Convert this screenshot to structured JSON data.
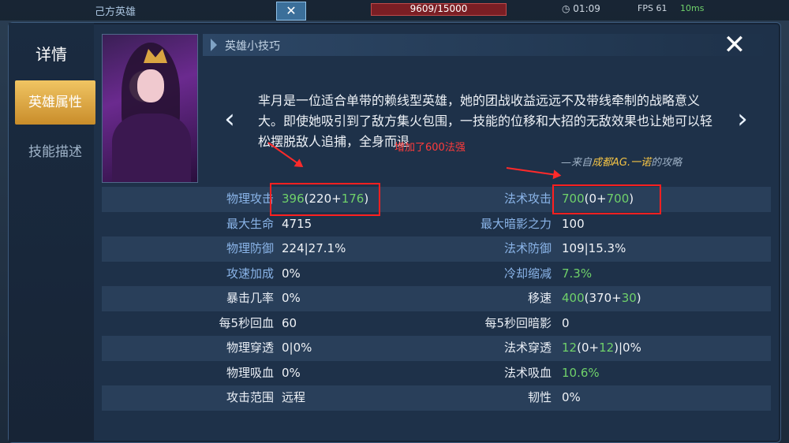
{
  "hud": {
    "ally_label": "己方英雄",
    "hp_text": "9609/15000",
    "time": "01:09",
    "fps": "FPS 61",
    "ping": "10ms"
  },
  "sidebar": {
    "title": "详情",
    "tabs": [
      {
        "label": "英雄属性",
        "active": true
      },
      {
        "label": "技能描述",
        "active": false
      }
    ]
  },
  "tips": {
    "header": "英雄小技巧",
    "text": "芈月是一位适合单带的赖线型英雄，她的团战收益远远不及带线牵制的战略意义大。即使她吸引到了敌方集火包围，一技能的位移和大招的无敌效果也让她可以轻松摆脱敌人追捕，全身而退",
    "source_prefix": "—来自",
    "source_name": "成都AG.一诺",
    "source_suffix": "的攻略"
  },
  "annotation": {
    "label": "增加了600法强",
    "color": "#ff2020"
  },
  "stats": [
    {
      "l_label": "物理攻击",
      "l_color": "blue",
      "l_parts": [
        [
          "396",
          "g"
        ],
        [
          "(220+",
          ""
        ],
        [
          "176",
          "g"
        ],
        [
          ")",
          ""
        ]
      ],
      "r_label": "法术攻击",
      "r_color": "blue",
      "r_parts": [
        [
          "700",
          "g"
        ],
        [
          "(0+",
          ""
        ],
        [
          "700",
          "g"
        ],
        [
          ")",
          ""
        ]
      ]
    },
    {
      "l_label": "最大生命",
      "l_color": "blue",
      "l_parts": [
        [
          "4715",
          ""
        ]
      ],
      "r_label": "最大暗影之力",
      "r_color": "blue",
      "r_parts": [
        [
          "100",
          ""
        ]
      ]
    },
    {
      "l_label": "物理防御",
      "l_color": "blue",
      "l_parts": [
        [
          "224|27.1%",
          ""
        ]
      ],
      "r_label": "法术防御",
      "r_color": "blue",
      "r_parts": [
        [
          "109|15.3%",
          ""
        ]
      ]
    },
    {
      "l_label": "攻速加成",
      "l_color": "blue",
      "l_parts": [
        [
          "0%",
          ""
        ]
      ],
      "r_label": "冷却缩减",
      "r_color": "blue",
      "r_parts": [
        [
          "7.3%",
          "g"
        ]
      ]
    },
    {
      "l_label": "暴击几率",
      "l_color": "white",
      "l_parts": [
        [
          "0%",
          ""
        ]
      ],
      "r_label": "移速",
      "r_color": "white",
      "r_parts": [
        [
          "400",
          "g"
        ],
        [
          "(370+",
          ""
        ],
        [
          "30",
          "g"
        ],
        [
          ")",
          ""
        ]
      ]
    },
    {
      "l_label": "每5秒回血",
      "l_color": "white",
      "l_parts": [
        [
          "60",
          ""
        ]
      ],
      "r_label": "每5秒回暗影",
      "r_color": "white",
      "r_parts": [
        [
          "0",
          ""
        ]
      ]
    },
    {
      "l_label": "物理穿透",
      "l_color": "white",
      "l_parts": [
        [
          "0|0%",
          ""
        ]
      ],
      "r_label": "法术穿透",
      "r_color": "white",
      "r_parts": [
        [
          "12",
          "g"
        ],
        [
          "(0+",
          ""
        ],
        [
          "12",
          "g"
        ],
        [
          ")|0%",
          ""
        ]
      ]
    },
    {
      "l_label": "物理吸血",
      "l_color": "white",
      "l_parts": [
        [
          "0%",
          ""
        ]
      ],
      "r_label": "法术吸血",
      "r_color": "white",
      "r_parts": [
        [
          "10.6%",
          "g"
        ]
      ]
    },
    {
      "l_label": "攻击范围",
      "l_color": "white",
      "l_parts": [
        [
          "远程",
          ""
        ]
      ],
      "r_label": "韧性",
      "r_color": "white",
      "r_parts": [
        [
          "0%",
          ""
        ]
      ]
    }
  ]
}
